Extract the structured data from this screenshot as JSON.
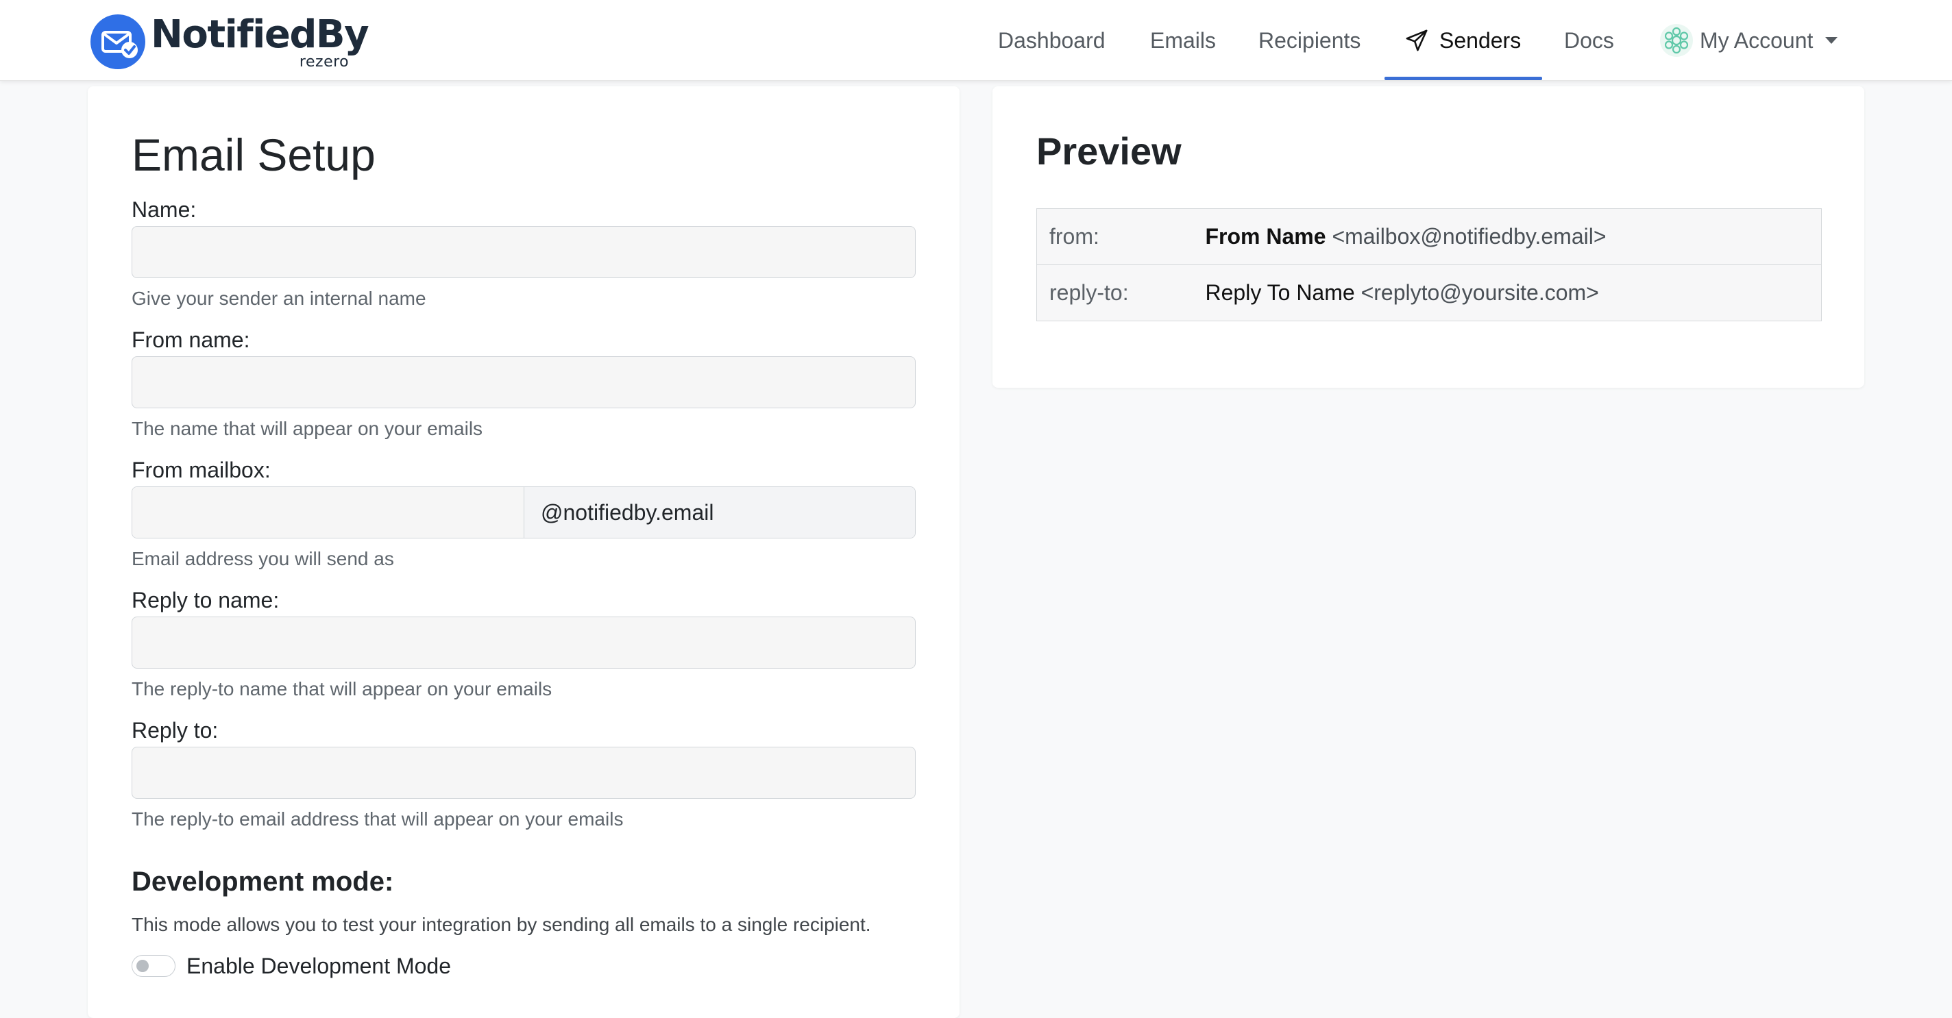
{
  "brand": {
    "name": "NotifiedBy",
    "sub": "rezero",
    "color": "#2f6fe6"
  },
  "nav": {
    "items": [
      {
        "label": "Dashboard"
      },
      {
        "label": "Emails"
      },
      {
        "label": "Recipients"
      },
      {
        "label": "Senders",
        "active": true,
        "icon": "send-icon"
      },
      {
        "label": "Docs"
      }
    ],
    "account": {
      "label": "My Account",
      "icon": "account-avatar-icon"
    },
    "active_color": "#3b6fd6"
  },
  "setup": {
    "title": "Email Setup",
    "fields": {
      "name": {
        "label": "Name:",
        "value": "",
        "help": "Give your sender an internal name"
      },
      "from_name": {
        "label": "From name:",
        "value": "",
        "help": "The name that will appear on your emails"
      },
      "from_mailbox": {
        "label": "From mailbox:",
        "value": "",
        "suffix": "@notifiedby.email",
        "help": "Email address you will send as"
      },
      "reply_to_name": {
        "label": "Reply to name:",
        "value": "",
        "help": "The reply-to name that will appear on your emails"
      },
      "reply_to": {
        "label": "Reply to:",
        "value": "",
        "help": "The reply-to email address that will appear on your emails"
      }
    },
    "dev_mode": {
      "heading": "Development mode:",
      "description": "This mode allows you to test your integration by sending all emails to a single recipient.",
      "toggle_label": "Enable Development Mode",
      "enabled": false
    }
  },
  "preview": {
    "title": "Preview",
    "rows": [
      {
        "key": "from:",
        "name": "From Name",
        "address": "<mailbox@notifiedby.email>"
      },
      {
        "key": "reply-to:",
        "name": "Reply To Name",
        "address": "<replyto@yoursite.com>"
      }
    ]
  }
}
